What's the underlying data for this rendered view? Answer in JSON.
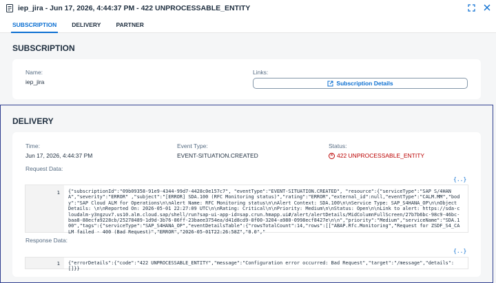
{
  "window": {
    "title": "iep_jira - Jun 17, 2026, 4:44:37 PM - 422 UNPROCESSABLE_ENTITY",
    "fullscreen_icon": "fullscreen-icon",
    "close_icon": "close-icon"
  },
  "tabs": [
    {
      "label": "SUBSCRIPTION",
      "active": true
    },
    {
      "label": "DELIVERY",
      "active": false
    },
    {
      "label": "PARTNER",
      "active": false
    }
  ],
  "subscription": {
    "title": "SUBSCRIPTION",
    "name_label": "Name:",
    "name_value": "iep_jira",
    "links_label": "Links:",
    "details_button": "Subscription Details"
  },
  "delivery": {
    "title": "DELIVERY",
    "time_label": "Time:",
    "time_value": "Jun 17, 2026, 4:44:37 PM",
    "event_type_label": "Event Type:",
    "event_type_value": "EVENT-SITUATION.CREATED",
    "status_label": "Status:",
    "status_value": "422 UNPROCESSABLE_ENTITY",
    "status_color": "#bb0000",
    "request_label": "Request Data:",
    "request_line_no": "1",
    "request_code": "{\"subscriptionId\":\"09b09358-91e9-4344-99d7-4428c0e157c7\", \"eventType\":\"EVENT-SITUATION.CREATED\", \"resource\":{\"serviceType\":\"SAP S/4HANA\",\"severity\":\"ERROR\" ,\"subject\":\"[ERROR] SDA.100 (RFC Monitoring status)\",\"rating\":\"ERROR\",\"external_id\":null,\"eventType\":\"CALM.MM\",\"body\":\"SAP Cloud ALM for Operations\\n\\nAlert Name: RFC Monitoring status\\n\\nAlert Context: SDA.100\\n\\nService Type: SAP_S4HANA_OP\\n\\nObject Details: \\n\\nReported On: 2026-05-01 22:27:09 UTC\\n\\nRating: Critical\\n\\nPriority: Medium\\n\\nStatus: Open\\n\\nLink to alert: https://sda-cloudalm-y3ngzuv7.us10.alm.cloud.sap/shell/run?sap-ui-app-id=sap.crun.hmapp.ui#/alert/alertDetails/MidColumnFullScreen/27b7b6bc-98c9-46bc-baa8-88ecfa9228cb/25278489-1d9d-3b76-86ff-23baee3754ea/d41d8cd9-8f00-3204-a980-0998ecf8427e\\n\\n\",\"priority\":\"Medium\",\"serviceName\":\"SDA.100\",\"tags\":{\"serviceType\":\"SAP_S4HANA_OP\",\"eventDetailsTable\":{\"rowsTotalCount\":14,\"rows\":[[\"ABAP.Rfc.Monitoring\",\"Request for ZSDF_S4_CALM failed - 400 (Bad Request)\",\"ERROR\",\"2026-05-01T22:26:58Z\",\"0.0\",\"",
    "response_label": "Response Data:",
    "response_line_no": "1",
    "response_code": "{\"errorDetails\":{\"code\":\"422 UNPROCESSABLE_ENTITY\",\"message\":\"Configuration error occurred: Bad Request\",\"target\":\"/message\",\"details\":[]}}",
    "expand_icon_glyph": "{..}"
  },
  "colors": {
    "accent": "#0a6ed1",
    "highlight_frame": "#2e3d8f"
  }
}
